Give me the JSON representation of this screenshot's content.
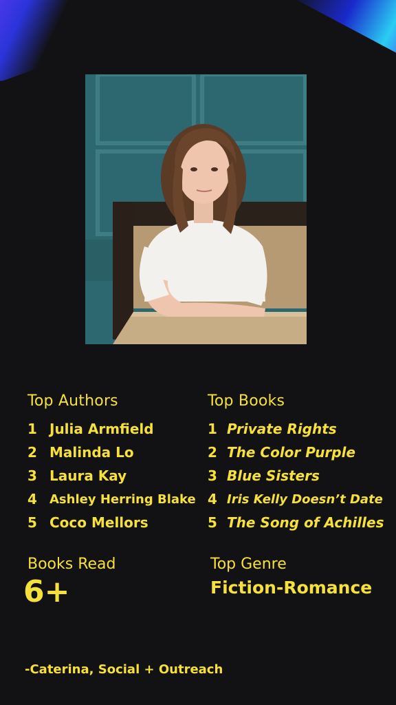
{
  "photo": {
    "icon": "portrait-photo"
  },
  "top_authors": {
    "heading": "Top Authors",
    "items": [
      {
        "rank": "1",
        "label": "Julia Armfield"
      },
      {
        "rank": "2",
        "label": "Malinda Lo"
      },
      {
        "rank": "3",
        "label": "Laura Kay"
      },
      {
        "rank": "4",
        "label": "Ashley Herring Blake"
      },
      {
        "rank": "5",
        "label": "Coco Mellors"
      }
    ]
  },
  "top_books": {
    "heading": "Top Books",
    "items": [
      {
        "rank": "1",
        "label": "Private Rights"
      },
      {
        "rank": "2",
        "label": "The Color Purple"
      },
      {
        "rank": "3",
        "label": "Blue Sisters"
      },
      {
        "rank": "4",
        "label": "Iris Kelly Doesn’t Date"
      },
      {
        "rank": "5",
        "label": "The Song of Achilles"
      }
    ]
  },
  "books_read": {
    "label": "Books Read",
    "value": "6+"
  },
  "top_genre": {
    "label": "Top Genre",
    "value": "Fiction-Romance"
  },
  "signature": "-Caterina, Social + Outreach",
  "colors": {
    "background": "#121214",
    "accent": "#f6e03c"
  }
}
